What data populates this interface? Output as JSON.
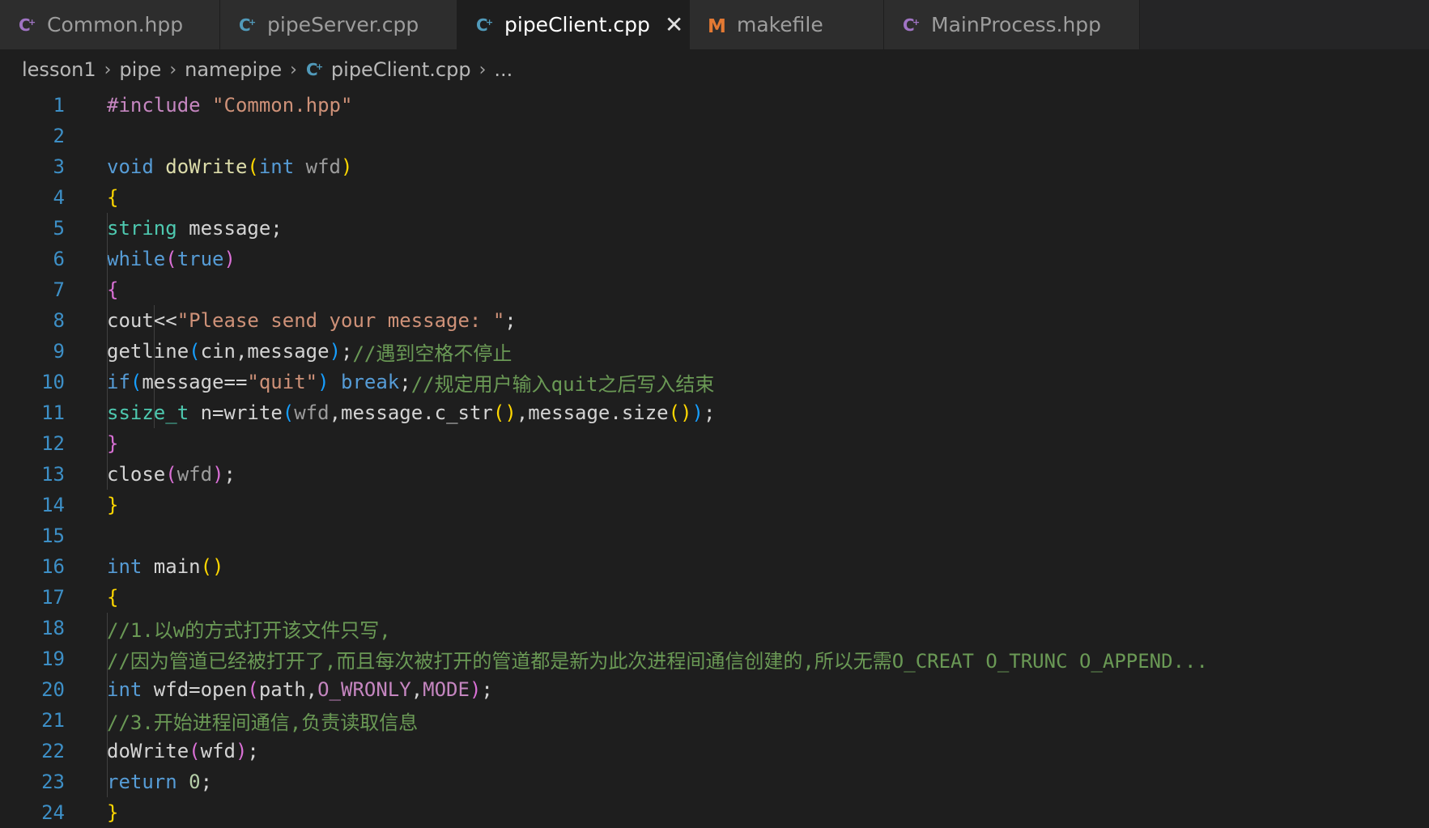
{
  "tabs": [
    {
      "label": "Common.hpp",
      "icon": "cpp-icon",
      "active": false
    },
    {
      "label": "pipeServer.cpp",
      "icon": "cpp-icon",
      "active": false
    },
    {
      "label": "pipeClient.cpp",
      "icon": "cpp-icon",
      "active": true
    },
    {
      "label": "makefile",
      "icon": "makefile-icon",
      "active": false
    },
    {
      "label": "MainProcess.hpp",
      "icon": "cpp-icon",
      "active": false
    }
  ],
  "breadcrumb": [
    "lesson1",
    "pipe",
    "namepipe",
    "pipeClient.cpp",
    "..."
  ],
  "line_numbers": [
    "1",
    "2",
    "3",
    "4",
    "5",
    "6",
    "7",
    "8",
    "9",
    "10",
    "11",
    "12",
    "13",
    "14",
    "15",
    "16",
    "17",
    "18",
    "19",
    "20",
    "21",
    "22",
    "23",
    "24"
  ],
  "code": {
    "l1": {
      "a": "#include ",
      "b": "\"Common.hpp\""
    },
    "l3": {
      "a": "void",
      "b": " doWrite",
      "c": "(",
      "d": "int",
      "e": " wfd",
      "f": ")"
    },
    "l4": {
      "a": "{"
    },
    "l5": {
      "a": "string",
      "b": " message;"
    },
    "l6": {
      "a": "while",
      "b": "(",
      "c": "true",
      "d": ")"
    },
    "l7": {
      "a": "{"
    },
    "l8": {
      "a": "cout<<",
      "b": "\"Please send your message: \"",
      "c": ";"
    },
    "l9": {
      "a": "getline",
      "b": "(",
      "c": "cin,message",
      "d": ")",
      "e": ";",
      "f": "//遇到空格不停止"
    },
    "l10": {
      "a": "if",
      "b": "(",
      "c": "message==",
      "d": "\"quit\"",
      "e": ")",
      "f": " break",
      "g": ";",
      "h": "//规定用户输入quit之后写入结束"
    },
    "l11": {
      "a": "ssize_t",
      "b": " n=",
      "c": "write",
      "d": "(",
      "e": "wfd",
      "f": ",message.",
      "g": "c_str",
      "h": "()",
      "i": ",message.",
      "j": "size",
      "k": "()",
      "l": ")",
      "m": ";"
    },
    "l12": {
      "a": "}"
    },
    "l13": {
      "a": "close",
      "b": "(",
      "c": "wfd",
      "d": ")",
      "e": ";"
    },
    "l14": {
      "a": "}"
    },
    "l16": {
      "a": "int",
      "b": " main",
      "c": "()"
    },
    "l17": {
      "a": "{"
    },
    "l18": {
      "a": "//1.以w的方式打开该文件只写,"
    },
    "l19": {
      "a": "//因为管道已经被打开了,而且每次被打开的管道都是新为此次进程间通信创建的,所以无需O_CREAT O_TRUNC O_APPEND..."
    },
    "l20": {
      "a": "int",
      "b": " wfd=",
      "c": "open",
      "d": "(",
      "e": "path,",
      "f": "O_WRONLY",
      "g": ",",
      "h": "MODE",
      "i": ")",
      "j": ";"
    },
    "l21": {
      "a": "//3.开始进程间通信,负责读取信息"
    },
    "l22": {
      "a": "doWrite",
      "b": "(",
      "c": "wfd",
      "d": ")",
      "e": ";"
    },
    "l23": {
      "a": "return",
      "b": " 0",
      "c": ";"
    },
    "l24": {
      "a": "}"
    }
  },
  "colors": {
    "background": "#1e1e1e",
    "tab_inactive": "#2d2d2d",
    "keyword": "#569cd6",
    "string": "#ce9178",
    "comment": "#6a9955",
    "type": "#4ec9b0",
    "function": "#dcdcaa"
  }
}
